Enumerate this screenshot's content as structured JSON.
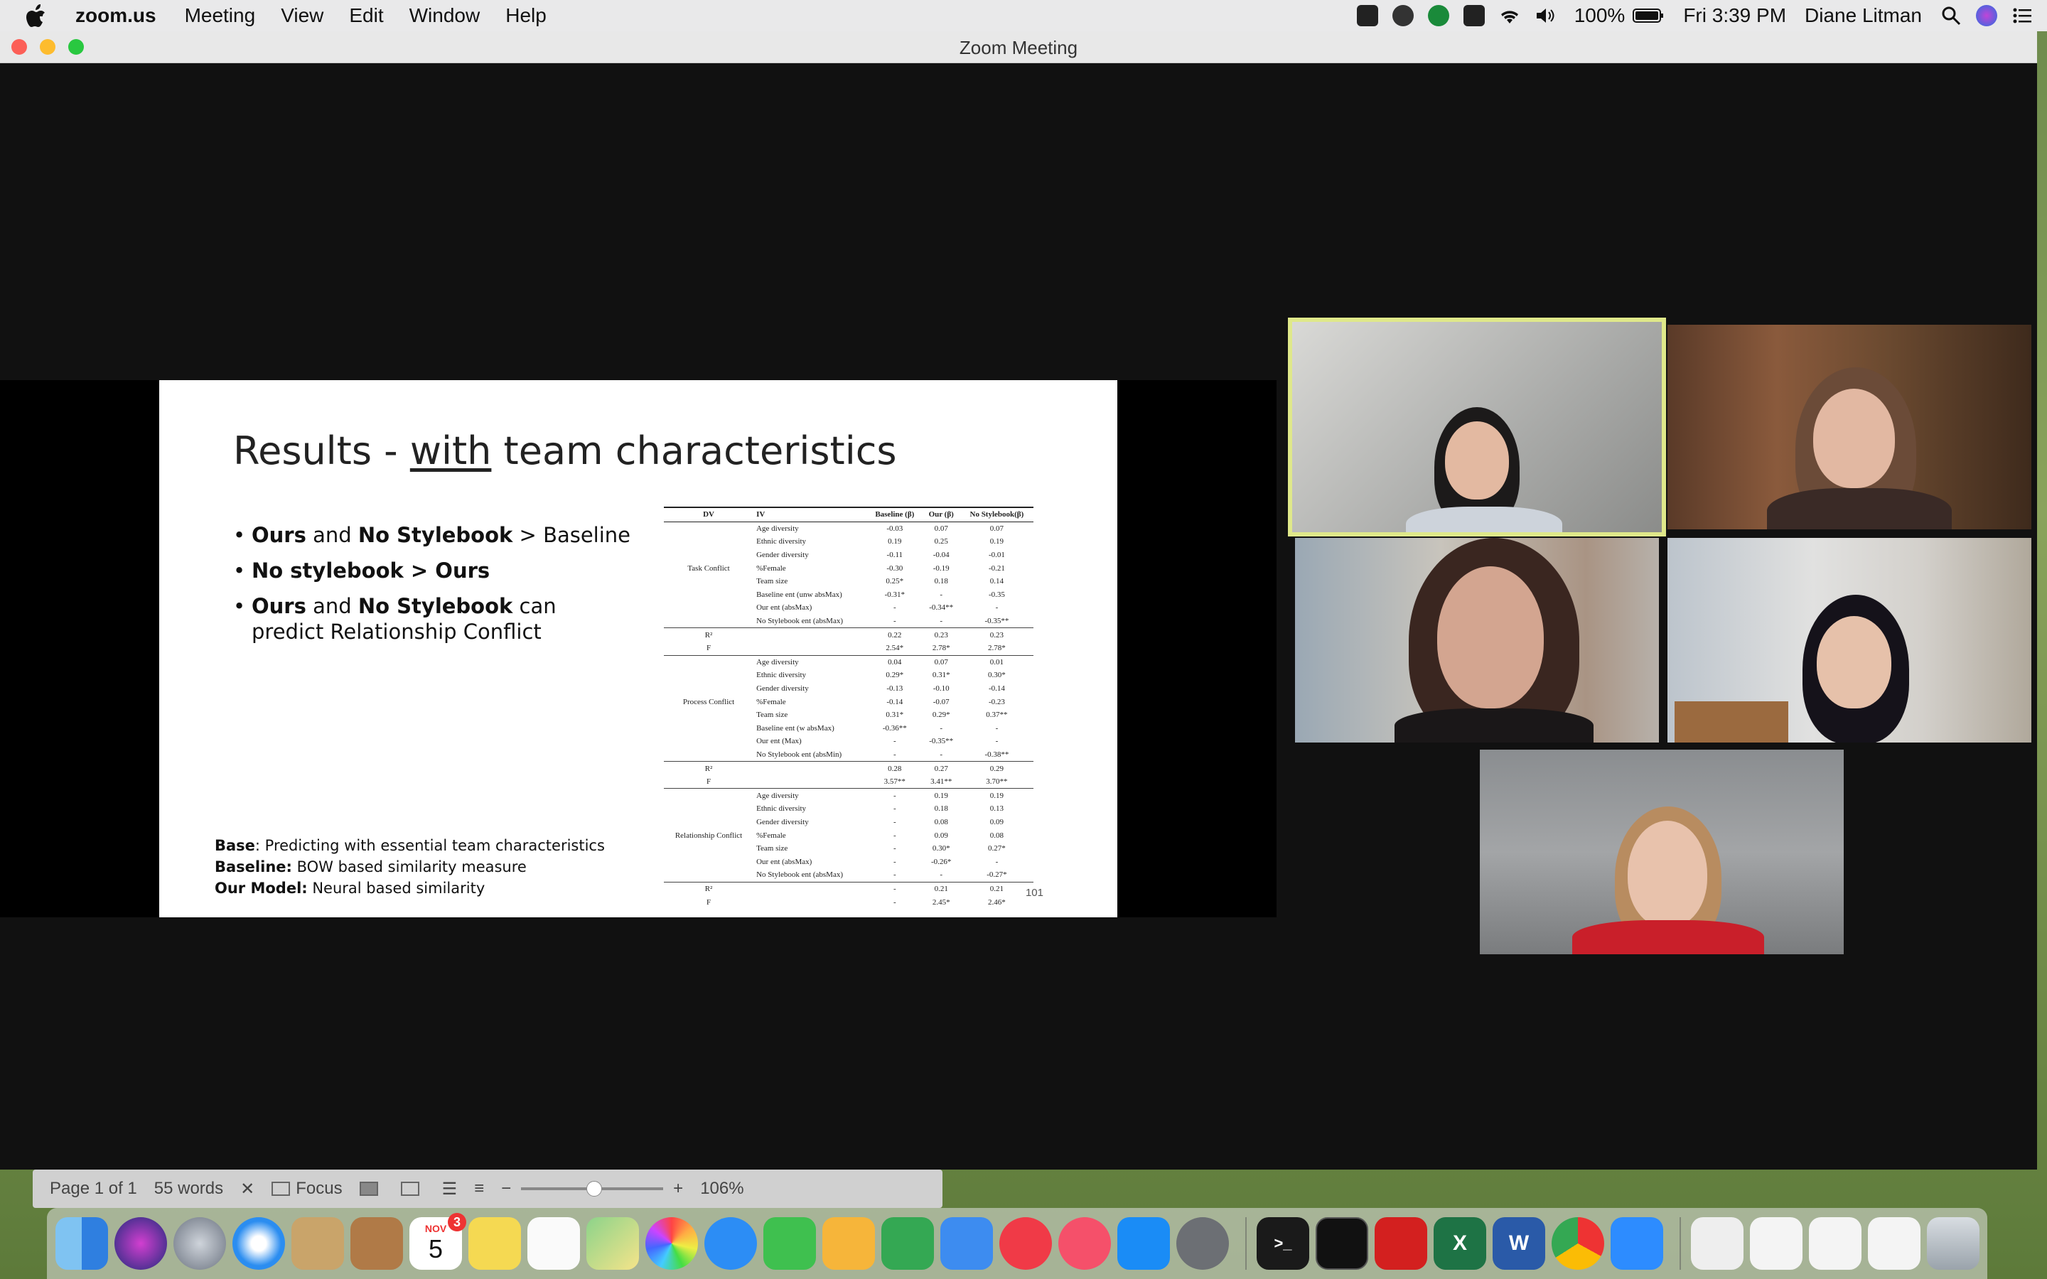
{
  "menubar": {
    "app_name": "zoom.us",
    "menus": [
      "Meeting",
      "View",
      "Edit",
      "Window",
      "Help"
    ],
    "battery": "100%",
    "clock": "Fri 3:39 PM",
    "user": "Diane Litman"
  },
  "window": {
    "title": "Zoom Meeting"
  },
  "slide": {
    "title_pre": "Results - ",
    "title_underlined": "with",
    "title_post": " team characteristics",
    "bullets": [
      {
        "b1": "Ours",
        "t1": " and ",
        "b2": "No Stylebook",
        "t2": " > Baseline"
      },
      {
        "b1": "No stylebook > Ours",
        "t1": "",
        "b2": "",
        "t2": ""
      },
      {
        "b1": "Ours",
        "t1": " and ",
        "b2": "No Stylebook",
        "t2": " can predict Relationship Conflict"
      }
    ],
    "notes": [
      {
        "label": "Base",
        "text": ": Predicting with essential team characteristics"
      },
      {
        "label": "Baseline:",
        "text": " BOW based similarity measure"
      },
      {
        "label": "Our Model:",
        "text": " Neural based similarity"
      }
    ],
    "page_number": "101",
    "table": {
      "headers": [
        "DV",
        "IV",
        "Baseline (β)",
        "Our (β)",
        "No Stylebook(β)"
      ],
      "rows": [
        {
          "dv": "",
          "iv": "Age diversity",
          "v": [
            "-0.03",
            "0.07",
            "0.07"
          ]
        },
        {
          "dv": "",
          "iv": "Ethnic diversity",
          "v": [
            "0.19",
            "0.25",
            "0.19"
          ]
        },
        {
          "dv": "",
          "iv": "Gender diversity",
          "v": [
            "-0.11",
            "-0.04",
            "-0.01"
          ]
        },
        {
          "dv": "Task Conflict",
          "iv": "%Female",
          "v": [
            "-0.30",
            "-0.19",
            "-0.21"
          ]
        },
        {
          "dv": "",
          "iv": "Team size",
          "v": [
            "0.25*",
            "0.18",
            "0.14"
          ]
        },
        {
          "dv": "",
          "iv": "Baseline ent (unw absMax)",
          "v": [
            "-0.31*",
            "-",
            "-0.35"
          ]
        },
        {
          "dv": "",
          "iv": "Our ent (absMax)",
          "v": [
            "-",
            "-0.34**",
            "-"
          ]
        },
        {
          "dv": "",
          "iv": "No Stylebook ent (absMax)",
          "v": [
            "-",
            "-",
            "-0.35**"
          ]
        },
        {
          "dv": "R²",
          "iv": "",
          "v": [
            "0.22",
            "0.23",
            "0.23"
          ],
          "sep": true
        },
        {
          "dv": "F",
          "iv": "",
          "v": [
            "2.54*",
            "2.78*",
            "2.78*"
          ]
        },
        {
          "dv": "",
          "iv": "Age diversity",
          "v": [
            "0.04",
            "0.07",
            "0.01"
          ],
          "sep": true
        },
        {
          "dv": "",
          "iv": "Ethnic diversity",
          "v": [
            "0.29*",
            "0.31*",
            "0.30*"
          ]
        },
        {
          "dv": "",
          "iv": "Gender diversity",
          "v": [
            "-0.13",
            "-0.10",
            "-0.14"
          ]
        },
        {
          "dv": "Process Conflict",
          "iv": "%Female",
          "v": [
            "-0.14",
            "-0.07",
            "-0.23"
          ]
        },
        {
          "dv": "",
          "iv": "Team size",
          "v": [
            "0.31*",
            "0.29*",
            "0.37**"
          ]
        },
        {
          "dv": "",
          "iv": "Baseline ent (w absMax)",
          "v": [
            "-0.36**",
            "-",
            "-"
          ]
        },
        {
          "dv": "",
          "iv": "Our ent (Max)",
          "v": [
            "-",
            "-0.35**",
            "-"
          ]
        },
        {
          "dv": "",
          "iv": "No Stylebook ent (absMin)",
          "v": [
            "-",
            "-",
            "-0.38**"
          ]
        },
        {
          "dv": "R²",
          "iv": "",
          "v": [
            "0.28",
            "0.27",
            "0.29"
          ],
          "sep": true
        },
        {
          "dv": "F",
          "iv": "",
          "v": [
            "3.57**",
            "3.41**",
            "3.70**"
          ]
        },
        {
          "dv": "",
          "iv": "Age diversity",
          "v": [
            "-",
            "0.19",
            "0.19"
          ],
          "sep": true
        },
        {
          "dv": "",
          "iv": "Ethnic diversity",
          "v": [
            "-",
            "0.18",
            "0.13"
          ]
        },
        {
          "dv": "",
          "iv": "Gender diversity",
          "v": [
            "-",
            "0.08",
            "0.09"
          ]
        },
        {
          "dv": "Relationship Conflict",
          "iv": "%Female",
          "v": [
            "-",
            "0.09",
            "0.08"
          ]
        },
        {
          "dv": "",
          "iv": "Team size",
          "v": [
            "-",
            "0.30*",
            "0.27*"
          ]
        },
        {
          "dv": "",
          "iv": "Our ent (absMax)",
          "v": [
            "-",
            "-0.26*",
            "-"
          ]
        },
        {
          "dv": "",
          "iv": "No Stylebook ent (absMax)",
          "v": [
            "-",
            "-",
            "-0.27*"
          ]
        },
        {
          "dv": "R²",
          "iv": "",
          "v": [
            "-",
            "0.21",
            "0.21"
          ],
          "sep": true
        },
        {
          "dv": "F",
          "iv": "",
          "v": [
            "-",
            "2.45*",
            "2.46*"
          ]
        }
      ]
    }
  },
  "statusbar": {
    "page": "Page 1 of 1",
    "words": "55 words",
    "focus": "Focus",
    "zoom": "106%"
  },
  "dock": {
    "calendar_month": "NOV",
    "calendar_day": "5",
    "calendar_badge": "3"
  }
}
